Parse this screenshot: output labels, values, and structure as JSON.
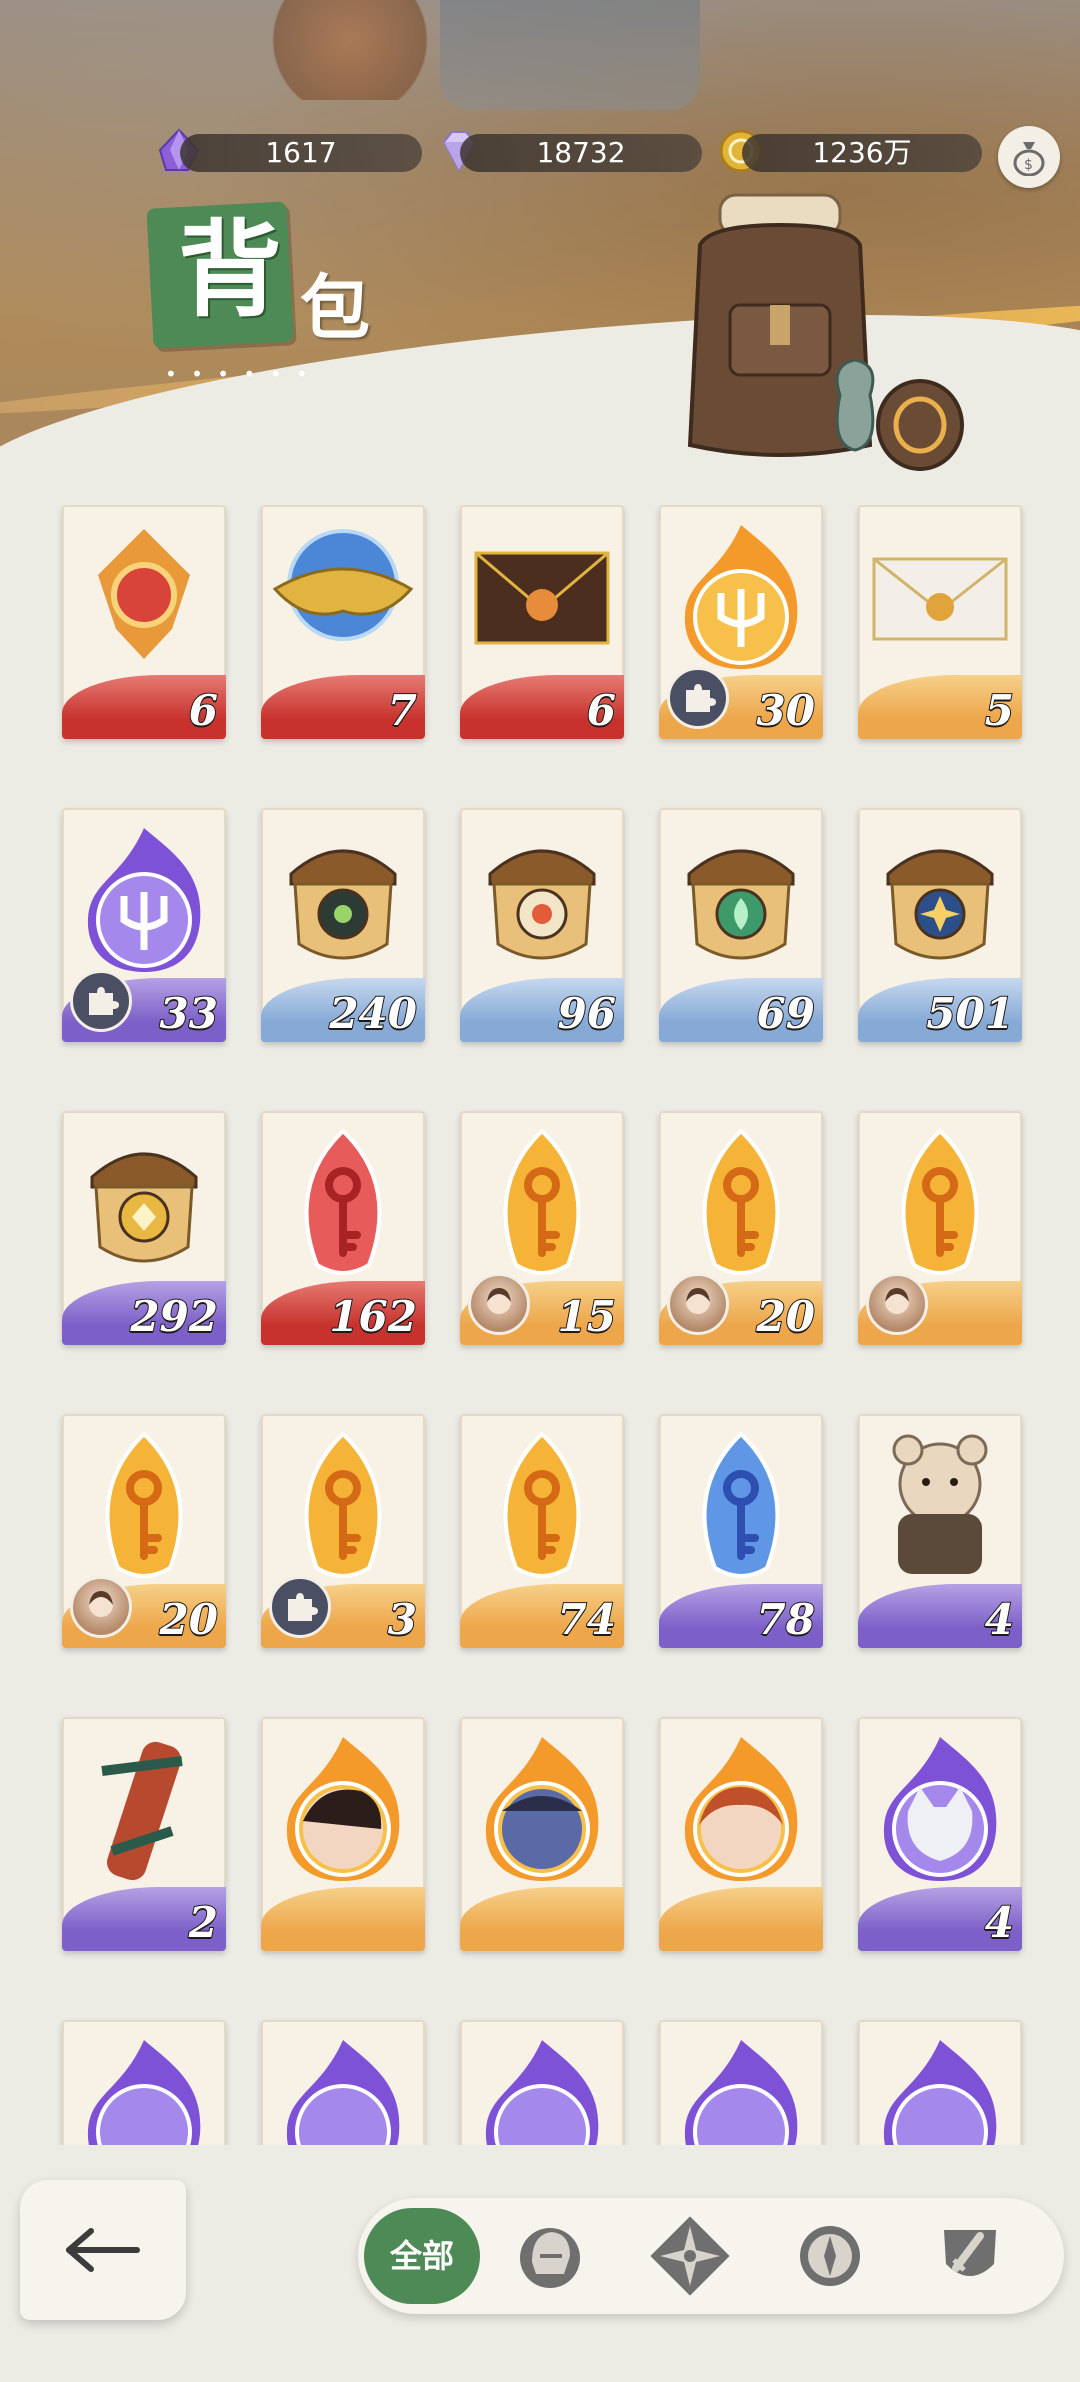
{
  "header": {
    "title_main": "背",
    "title_sub": "包",
    "title_dots": "• • • • • •",
    "currencies": [
      {
        "name": "purple-crystal",
        "value": "1617",
        "icon": "purple-crystal-icon",
        "color": "#8b5fd6"
      },
      {
        "name": "diamond",
        "value": "18732",
        "icon": "diamond-icon",
        "color": "#c9b6f0"
      },
      {
        "name": "gold-coin",
        "value": "1236万",
        "icon": "gold-coin-icon",
        "color": "#e2b43a"
      }
    ],
    "bag_button_icon": "money-bag-icon"
  },
  "items": [
    {
      "icon": "red-amulet-icon",
      "count": "6",
      "band": "red"
    },
    {
      "icon": "blue-orb-mask-icon",
      "count": "7",
      "band": "red"
    },
    {
      "icon": "dark-envelope-icon",
      "count": "6",
      "band": "red"
    },
    {
      "icon": "fire-trident-shard-icon",
      "count": "30",
      "band": "orange",
      "badge": "puzzle"
    },
    {
      "icon": "white-envelope-icon",
      "count": "5",
      "band": "orange"
    },
    {
      "icon": "purple-trident-shard-icon",
      "count": "33",
      "band": "purple",
      "badge": "puzzle"
    },
    {
      "icon": "acorn-eye-icon",
      "count": "240",
      "band": "blue"
    },
    {
      "icon": "acorn-target-icon",
      "count": "96",
      "band": "blue"
    },
    {
      "icon": "acorn-leaf-icon",
      "count": "69",
      "band": "blue"
    },
    {
      "icon": "acorn-star-icon",
      "count": "501",
      "band": "blue"
    },
    {
      "icon": "acorn-diamond-icon",
      "count": "292",
      "band": "purple"
    },
    {
      "icon": "red-key-gem-icon",
      "count": "162",
      "band": "red"
    },
    {
      "icon": "gold-key-gem-icon",
      "count": "15",
      "band": "orange",
      "badge": "portrait"
    },
    {
      "icon": "gold-key-gem-icon",
      "count": "20",
      "band": "orange",
      "badge": "portrait"
    },
    {
      "icon": "gold-key-gem-icon",
      "count": "",
      "band": "orange",
      "badge": "portrait"
    },
    {
      "icon": "gold-key-gem-icon",
      "count": "20",
      "band": "orange",
      "badge": "portrait"
    },
    {
      "icon": "gold-key-gem-icon",
      "count": "3",
      "band": "orange",
      "badge": "puzzle"
    },
    {
      "icon": "gold-key-gem-icon",
      "count": "74",
      "band": "orange"
    },
    {
      "icon": "blue-key-gem-icon",
      "count": "78",
      "band": "purple"
    },
    {
      "icon": "bear-figure-icon",
      "count": "4",
      "band": "purple"
    },
    {
      "icon": "wrapped-scroll-icon",
      "count": "2",
      "band": "purple"
    },
    {
      "icon": "fire-portrait-elf-icon",
      "count": "",
      "band": "orange"
    },
    {
      "icon": "fire-portrait-blue-icon",
      "count": "",
      "band": "orange"
    },
    {
      "icon": "fire-portrait-redhair-icon",
      "count": "",
      "band": "orange"
    },
    {
      "icon": "purple-wolf-portrait-icon",
      "count": "4",
      "band": "purple"
    },
    {
      "icon": "purple-flame-icon",
      "count": "",
      "band": "purple"
    },
    {
      "icon": "purple-flame-icon",
      "count": "",
      "band": "purple"
    },
    {
      "icon": "purple-flame-icon",
      "count": "",
      "band": "purple"
    },
    {
      "icon": "purple-flame-icon",
      "count": "",
      "band": "purple"
    },
    {
      "icon": "purple-flame-icon",
      "count": "",
      "band": "purple"
    }
  ],
  "bottom": {
    "back_icon": "back-arrow-icon",
    "filter_all_label": "全部",
    "filters": [
      "helmet-icon",
      "compass-star-icon",
      "compass-icon",
      "shield-sword-icon"
    ]
  }
}
